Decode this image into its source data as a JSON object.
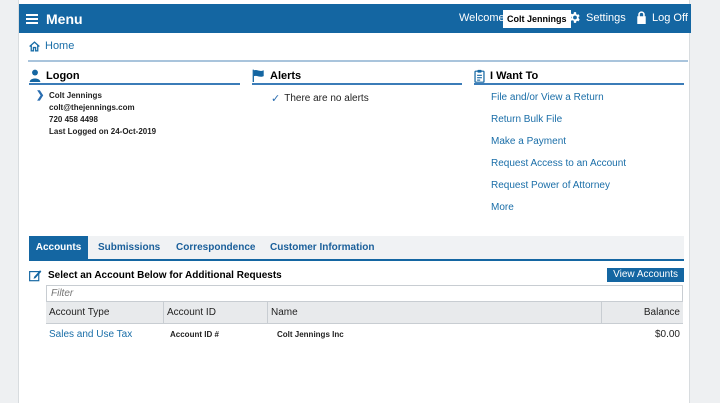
{
  "topbar": {
    "menu_label": "Menu",
    "welcome": "Welcome,",
    "user_name": "Colt Jennings",
    "settings_label": "Settings",
    "logoff_label": "Log Off"
  },
  "breadcrumb": {
    "home_label": "Home"
  },
  "logon": {
    "title": "Logon",
    "name": "Colt Jennings",
    "email": "colt@thejennings.com",
    "phone": "720 458 4498",
    "last_logged": "Last Logged on 24-Oct-2019"
  },
  "alerts": {
    "title": "Alerts",
    "message": "There are no alerts"
  },
  "iwant": {
    "title": "I Want To",
    "items": [
      "File and/or View a Return",
      "Return Bulk File",
      "Make a Payment",
      "Request Access to an Account",
      "Request Power of Attorney",
      "More"
    ]
  },
  "tabs": [
    {
      "label": "Accounts",
      "active": true
    },
    {
      "label": "Submissions"
    },
    {
      "label": "Correspondence"
    },
    {
      "label": "Customer Information"
    }
  ],
  "accounts": {
    "select_title": "Select an Account Below for Additional Requests",
    "view_button": "View Accounts",
    "filter_placeholder": "Filter",
    "columns": [
      "Account Type",
      "Account ID",
      "Name",
      "Balance"
    ],
    "rows": [
      {
        "type": "Sales and Use Tax",
        "id": "Account ID #",
        "name": "Colt Jennings Inc",
        "balance": "$0.00"
      }
    ]
  },
  "colors": {
    "primary": "#1466a2",
    "link": "#1a6ea8"
  }
}
